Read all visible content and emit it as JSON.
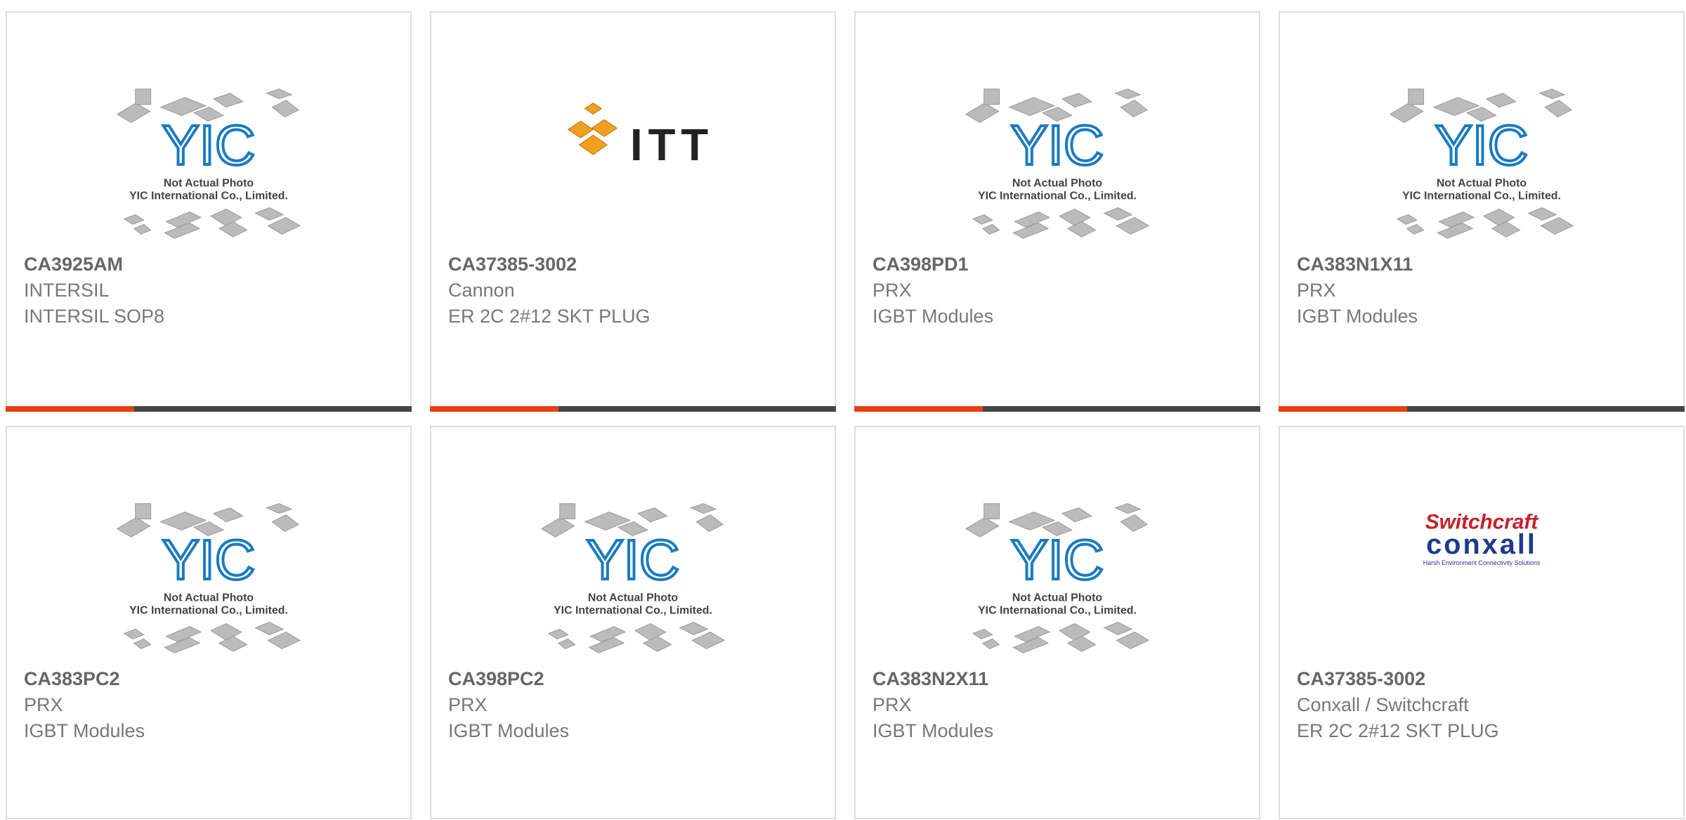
{
  "colors": {
    "accent": "#e64010",
    "bar": "#444444",
    "border": "#dddddd",
    "yic_blue": "#1a7bbf"
  },
  "placeholder": {
    "line1": "Not Actual Photo",
    "line2": "YIC International Co., Limited.",
    "logo": "YIC"
  },
  "brands": {
    "itt": "ITT",
    "switchcraft": "Switchcraft",
    "conxall": "conxall",
    "conxall_tagline": "Harsh Environment Connectivity Solutions"
  },
  "products": [
    {
      "part": "CA3925AM",
      "maker": "INTERSIL",
      "desc": "INTERSIL SOP8",
      "image": "yic-placeholder"
    },
    {
      "part": "CA37385-3002",
      "maker": "Cannon",
      "desc": "ER 2C 2#12 SKT PLUG",
      "image": "itt-logo"
    },
    {
      "part": "CA398PD1",
      "maker": "PRX",
      "desc": "IGBT Modules",
      "image": "yic-placeholder"
    },
    {
      "part": "CA383N1X11",
      "maker": "PRX",
      "desc": "IGBT Modules",
      "image": "yic-placeholder"
    },
    {
      "part": "CA383PC2",
      "maker": "PRX",
      "desc": "IGBT Modules",
      "image": "yic-placeholder"
    },
    {
      "part": "CA398PC2",
      "maker": "PRX",
      "desc": "IGBT Modules",
      "image": "yic-placeholder"
    },
    {
      "part": "CA383N2X11",
      "maker": "PRX",
      "desc": "IGBT Modules",
      "image": "yic-placeholder"
    },
    {
      "part": "CA37385-3002",
      "maker": "Conxall / Switchcraft",
      "desc": "ER 2C 2#12 SKT PLUG",
      "image": "switchcraft-conxall-logo"
    }
  ]
}
